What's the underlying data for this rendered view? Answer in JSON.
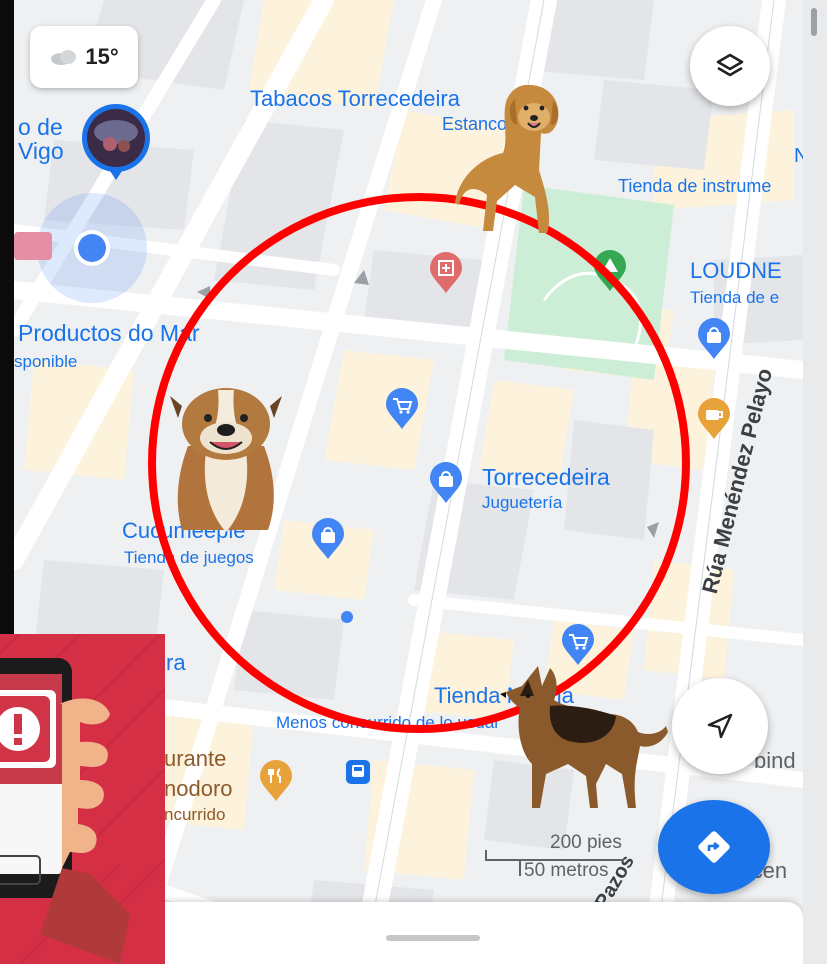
{
  "weather": {
    "temp": "15°",
    "icon": "cloud-icon"
  },
  "map": {
    "labels": {
      "tabacos": "Tabacos Torrecedeira",
      "estanco": "Estanco",
      "museo_line1": "o de",
      "museo_line2": "Vigo",
      "tienda_instrumentos": "Tienda de instrume",
      "loudne": "LOUDNE",
      "tienda_de_e": "Tienda de e",
      "productos": "Productos do Mar",
      "disponible": "sponible",
      "torrecedeira": "Torrecedeira",
      "jugueteria": "Juguetería",
      "cucomeeple": "Cucumeeple",
      "tienda_juegos": "Tienda de juegos",
      "street_pelayo": "Rúa Menéndez Pelayo",
      "street_pazos": "Pazos",
      "tienda_marina": "Tienda Marina",
      "menos_concurrido": "Menos concurrido de lo usual",
      "ra": "ra",
      "urante": "urante",
      "nodoro": "nodoro",
      "ncurrido": "ncurrido",
      "bind": "bind",
      "accen": "Accen",
      "m_partial": "N"
    },
    "scale": {
      "feet": "200 pies",
      "meters": "50 metros"
    }
  },
  "controls": {
    "layers_icon": "layers-icon",
    "locate_icon": "navigation-arrow-icon",
    "directions_icon": "directions-icon"
  },
  "overlay_alert": {
    "glyph": "!"
  },
  "colors": {
    "map_bg": "#f1f3f4",
    "road": "#ffffff",
    "block": "#fdf5df",
    "park": "#c8ecd0",
    "poi_blue": "#1a73e8",
    "ring": "#ff0000",
    "alert_bg": "#d42f45"
  }
}
